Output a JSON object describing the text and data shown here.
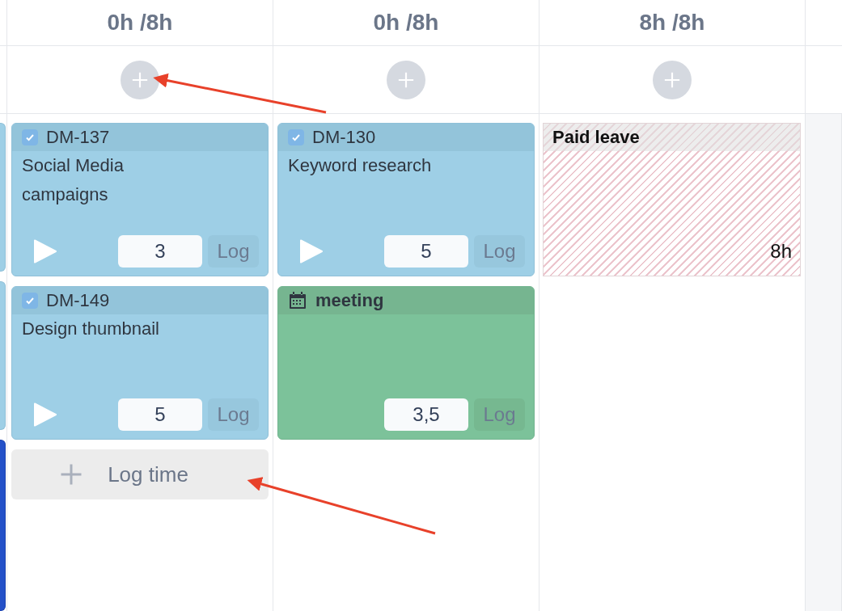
{
  "columns": [
    {
      "header": "0h /8h",
      "entries": [
        {
          "kind": "task",
          "checked": true,
          "key": "DM-137",
          "title": "Social Media campaigns",
          "hours": "3",
          "action": "Log"
        },
        {
          "kind": "task",
          "checked": true,
          "key": "DM-149",
          "title": "Design thumbnail",
          "hours": "5",
          "action": "Log"
        }
      ],
      "log_time": "Log time"
    },
    {
      "header": "0h /8h",
      "entries": [
        {
          "kind": "task",
          "checked": true,
          "key": "DM-130",
          "title": "Keyword research",
          "hours": "5",
          "action": "Log"
        },
        {
          "kind": "event",
          "title": "meeting",
          "hours": "3,5",
          "action": "Log"
        }
      ]
    },
    {
      "header": "8h /8h",
      "entries": [
        {
          "kind": "leave",
          "title": "Paid leave",
          "hours": "8h"
        }
      ]
    }
  ]
}
